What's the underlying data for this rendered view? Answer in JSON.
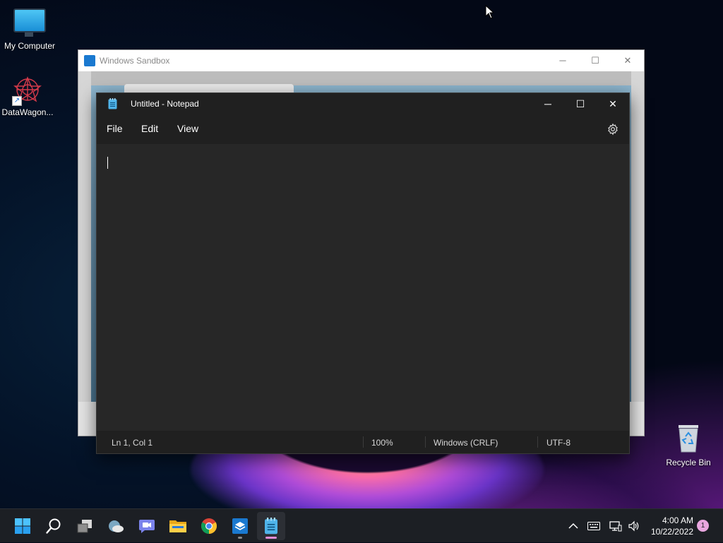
{
  "desktop": {
    "icons": [
      {
        "label": "My Computer",
        "icon": "monitor-icon"
      },
      {
        "label": "DataWagon...",
        "icon": "datawagon-icon"
      },
      {
        "label": "Recycle Bin",
        "icon": "recycle-bin-icon"
      }
    ]
  },
  "sandbox": {
    "title": "Windows Sandbox",
    "minimize": "─",
    "maximize": "☐",
    "close": "✕"
  },
  "notepad": {
    "title": "Untitled - Notepad",
    "minimize": "─",
    "maximize": "☐",
    "close": "✕",
    "menu": {
      "file": "File",
      "edit": "Edit",
      "view": "View"
    },
    "settings_icon": "gear-icon",
    "content": "",
    "status": {
      "position": "Ln 1, Col 1",
      "zoom": "100%",
      "line_ending": "Windows (CRLF)",
      "encoding": "UTF-8"
    }
  },
  "taskbar": {
    "apps": [
      {
        "name": "start",
        "icon": "windows-logo-icon"
      },
      {
        "name": "search",
        "icon": "search-icon"
      },
      {
        "name": "task-view",
        "icon": "task-view-icon"
      },
      {
        "name": "widgets",
        "icon": "weather-icon"
      },
      {
        "name": "chat",
        "icon": "teams-chat-icon"
      },
      {
        "name": "file-explorer",
        "icon": "folder-icon"
      },
      {
        "name": "chrome",
        "icon": "chrome-icon"
      },
      {
        "name": "windows-sandbox",
        "icon": "sandbox-icon"
      },
      {
        "name": "notepad",
        "icon": "notepad-icon"
      }
    ],
    "tray": {
      "chevron": "^",
      "time": "4:00 AM",
      "date": "10/22/2022",
      "notifications": "1"
    }
  },
  "colors": {
    "notepad_bg": "#272727",
    "titlebar_bg": "#202020",
    "accent": "#e38dd6",
    "taskbar_bg": "#1c1f24"
  }
}
